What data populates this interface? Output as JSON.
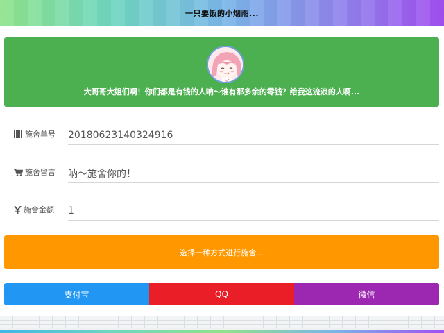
{
  "header": {
    "title": "一只要饭的小烟雨..."
  },
  "banner": {
    "message": "大哥哥大姐们啊！你们都是有钱的人呐～谁有那多余的零钱？给我这流浪的人啊...",
    "color": "#4caf50"
  },
  "form": {
    "order": {
      "icon": "barcode-icon",
      "label": "施舍单号",
      "value": "20180623140324916"
    },
    "note": {
      "icon": "cart-icon",
      "label": "施舍留言",
      "value": "呐～施舍你的！"
    },
    "amount": {
      "icon": "yen-icon",
      "label": "施舍金额",
      "value": "1"
    }
  },
  "pay_prompt": {
    "text": "选择一种方式进行施舍...",
    "color": "#ff9800"
  },
  "payment_methods": [
    {
      "label": "支付宝",
      "color": "#2196f3"
    },
    {
      "label": "QQ",
      "color": "#e91e26"
    },
    {
      "label": "微信",
      "color": "#9c27b0"
    }
  ]
}
